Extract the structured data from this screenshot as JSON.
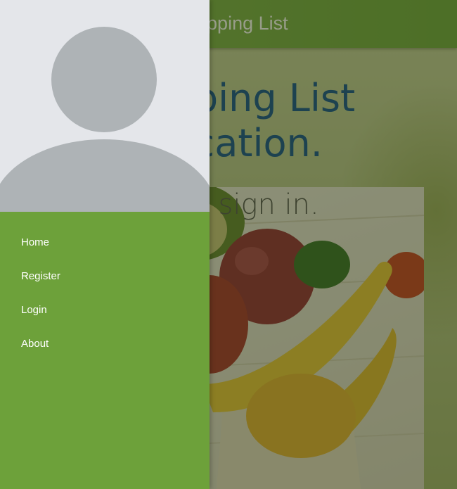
{
  "app_bar": {
    "title": "Shopping List"
  },
  "main": {
    "heading_line1": "Shopping List",
    "heading_line2": "Application.",
    "subheading": "Please sign in."
  },
  "drawer": {
    "items": [
      {
        "label": "Home"
      },
      {
        "label": "Register"
      },
      {
        "label": "Login"
      },
      {
        "label": "About"
      }
    ]
  },
  "colors": {
    "app_bar": "#6aa43a",
    "drawer_background": "#6da13a",
    "drawer_header": "#e4e6ea",
    "avatar": "#aeb3b6",
    "heading": "#0b4a8c"
  },
  "icons": {
    "avatar": "person-placeholder-icon"
  }
}
